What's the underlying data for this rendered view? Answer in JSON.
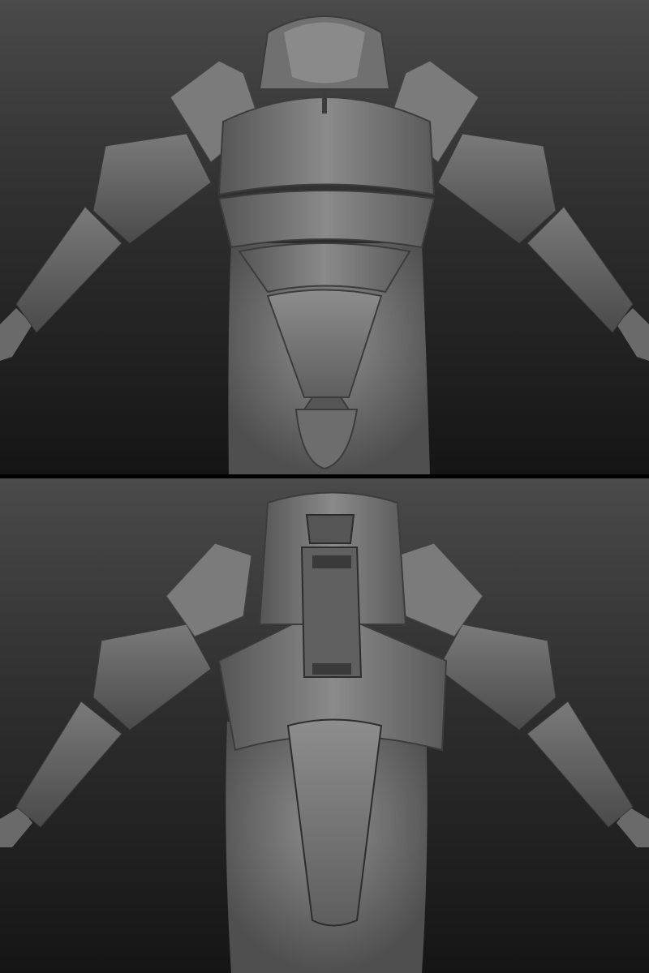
{
  "scene": {
    "subject": "armor-sculpt",
    "views": [
      {
        "id": "front",
        "label": ""
      },
      {
        "id": "back",
        "label": ""
      }
    ]
  },
  "colors": {
    "background_top": "#4a4a4a",
    "background_bottom": "#151515",
    "armor_light": "#8a8a8a",
    "armor_mid": "#6f6f6f",
    "armor_dark": "#4a4a4a",
    "body_light": "#8c8c8c",
    "body_dark": "#555555",
    "divider": "#000000"
  }
}
